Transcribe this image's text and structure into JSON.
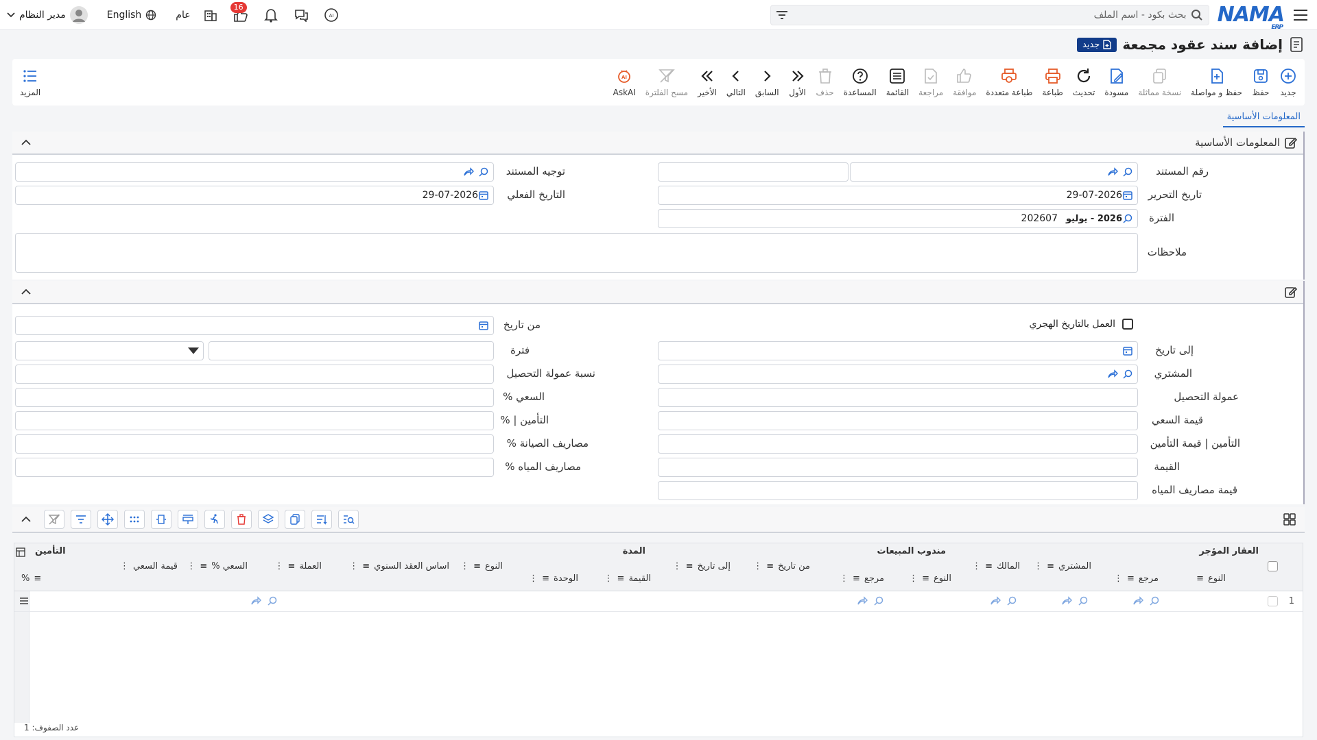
{
  "topbar": {
    "logo": "NAMA",
    "logo_sub": "ERP",
    "search_placeholder": "بحث بكود - اسم الملف",
    "language": "English",
    "branch": "عام",
    "notifications_count": "16",
    "user_name": "مدير النظام"
  },
  "page": {
    "title": "إضافة سند عقود مجمعة",
    "mode_badge": "جديد"
  },
  "toolbar": {
    "items": [
      {
        "label": "جديد",
        "icon": "plus-circle-icon"
      },
      {
        "label": "حفظ",
        "icon": "save-icon"
      },
      {
        "label": "حفظ و مواصلة",
        "icon": "save-continue-icon"
      },
      {
        "label": "نسخة مماثلة",
        "icon": "copy-icon"
      },
      {
        "label": "مسودة",
        "icon": "draft-icon"
      },
      {
        "label": "تحديث",
        "icon": "refresh-icon"
      },
      {
        "label": "طباعة",
        "icon": "print-icon"
      },
      {
        "label": "طباعة متعددة",
        "icon": "multi-print-icon"
      },
      {
        "label": "موافقة",
        "icon": "approve-icon"
      },
      {
        "label": "مراجعة",
        "icon": "review-icon"
      },
      {
        "label": "القائمة",
        "icon": "list-icon"
      },
      {
        "label": "المساعدة",
        "icon": "help-icon"
      },
      {
        "label": "حذف",
        "icon": "trash-icon"
      },
      {
        "label": "الأول",
        "icon": "first-icon"
      },
      {
        "label": "السابق",
        "icon": "prev-icon"
      },
      {
        "label": "التالي",
        "icon": "next-icon"
      },
      {
        "label": "الأخير",
        "icon": "last-icon"
      },
      {
        "label": "مسح الفلترة",
        "icon": "clear-filter-icon"
      },
      {
        "label": "AskAI",
        "icon": "ai-icon"
      }
    ],
    "more_label": "المزيد"
  },
  "tabs": [
    "المعلومات الأساسية"
  ],
  "basic_info": {
    "section_title": "المعلومات الأساسية",
    "doc_number_label": "رقم المستند",
    "doc_number_value": "",
    "doc_direction_label": "توجيه المستند",
    "edit_date_label": "تاريخ التحرير",
    "edit_date_value": "29-07-2026",
    "actual_date_label": "التاريخ الفعلي",
    "actual_date_value": "29-07-2026",
    "period_label": "الفترة",
    "period_value": "202607",
    "period_name": "2026 - يوليو",
    "notes_label": "ملاحظات"
  },
  "filters": {
    "hijri_label": "العمل بالتاريخ الهجري",
    "from_date_label": "من تاريخ",
    "to_date_label": "إلى تاريخ",
    "period_label": "فترة",
    "buyer_label": "المشتري",
    "collection_commission_rate_label": "نسبة عمولة التحصيل",
    "collection_commission_label": "عمولة التحصيل",
    "brokerage_pct_label": "السعي %",
    "brokerage_value_label": "قيمة السعي",
    "insurance_pct_label": "التأمين | %",
    "insurance_value_label": "التأمين | قيمة التأمين",
    "maintenance_pct_label": "مصاريف الصيانة %",
    "value_label": "القيمة",
    "water_pct_label": "مصاريف المياه %",
    "water_value_label": "قيمة مصاريف المياه"
  },
  "grid": {
    "groups": {
      "property": "العقار المؤجر",
      "sales_rep": "مندوب المبيعات",
      "duration": "المدة",
      "insurance": "التأمين"
    },
    "columns": {
      "type": "النوع",
      "ref": "مرجع",
      "buyer": "المشتري",
      "owner": "المالك",
      "rep_type": "النوع",
      "rep_ref": "مرجع",
      "from_date": "من تاريخ",
      "to_date": "إلى تاريخ",
      "dur_value": "القيمة",
      "dur_unit": "الوحدة",
      "kind": "النوع",
      "annual_basis": "اساس العقد السنوي",
      "currency": "العملة",
      "brokerage_pct": "السعي %",
      "brokerage_value": "قيمة السعي",
      "ins_pct": "%"
    },
    "row_number": "1",
    "footer": "عدد الصفوف: 1"
  }
}
